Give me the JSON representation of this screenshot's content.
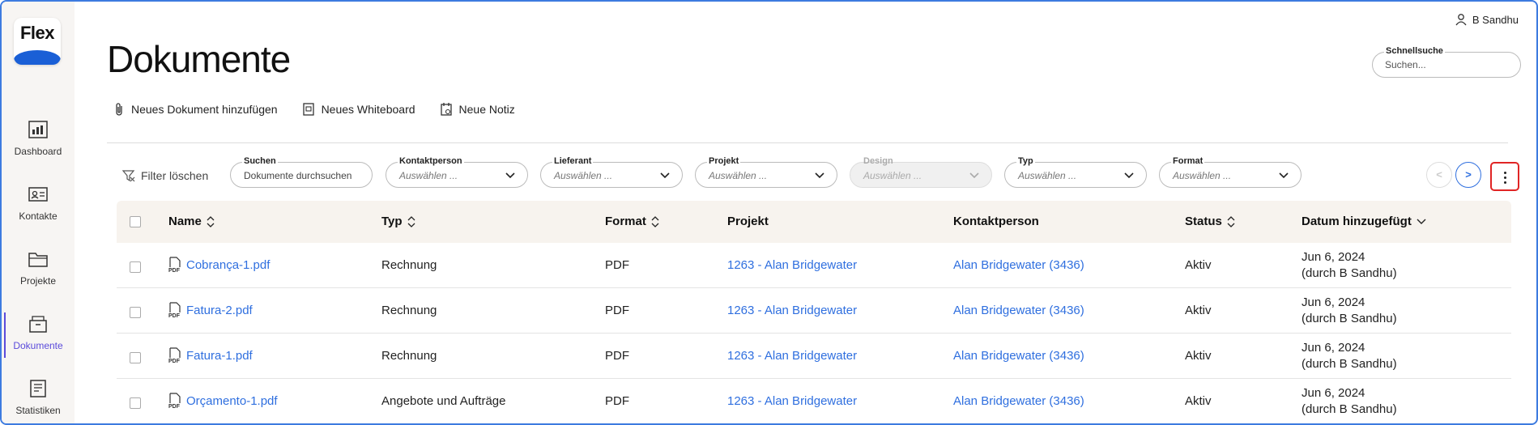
{
  "app": {
    "logo_text": "Flex"
  },
  "user": {
    "name": "B Sandhu"
  },
  "sidebar": {
    "items": [
      {
        "label": "Dashboard"
      },
      {
        "label": "Kontakte"
      },
      {
        "label": "Projekte"
      },
      {
        "label": "Dokumente",
        "active": true
      },
      {
        "label": "Statistiken"
      }
    ]
  },
  "page": {
    "title": "Dokumente"
  },
  "quicksearch": {
    "label": "Schnellsuche",
    "placeholder": "Suchen..."
  },
  "actions": {
    "new_document": "Neues Dokument hinzufügen",
    "new_whiteboard": "Neues Whiteboard",
    "new_note": "Neue Notiz"
  },
  "filters": {
    "clear_label": "Filter löschen",
    "search": {
      "label": "Suchen",
      "value": "Dokumente durchsuchen"
    },
    "contact": {
      "label": "Kontaktperson",
      "value": "Auswählen ..."
    },
    "supplier": {
      "label": "Lieferant",
      "value": "Auswählen ..."
    },
    "project": {
      "label": "Projekt",
      "value": "Auswählen ..."
    },
    "design": {
      "label": "Design",
      "value": "Auswählen ..."
    },
    "type": {
      "label": "Typ",
      "value": "Auswählen ..."
    },
    "format": {
      "label": "Format",
      "value": "Auswählen ..."
    }
  },
  "pager": {
    "prev": "<",
    "next": ">"
  },
  "table": {
    "headers": {
      "name": "Name",
      "type": "Typ",
      "format": "Format",
      "project": "Projekt",
      "contact": "Kontaktperson",
      "status": "Status",
      "date": "Datum hinzugefügt"
    },
    "rows": [
      {
        "name": "Cobrança-1.pdf",
        "type": "Rechnung",
        "format": "PDF",
        "project": "1263 - Alan Bridgewater",
        "contact": "Alan Bridgewater (3436)",
        "status": "Aktiv",
        "date": "Jun 6, 2024",
        "by": "(durch B Sandhu)"
      },
      {
        "name": "Fatura-2.pdf",
        "type": "Rechnung",
        "format": "PDF",
        "project": "1263 - Alan Bridgewater",
        "contact": "Alan Bridgewater (3436)",
        "status": "Aktiv",
        "date": "Jun 6, 2024",
        "by": "(durch B Sandhu)"
      },
      {
        "name": "Fatura-1.pdf",
        "type": "Rechnung",
        "format": "PDF",
        "project": "1263 - Alan Bridgewater",
        "contact": "Alan Bridgewater (3436)",
        "status": "Aktiv",
        "date": "Jun 6, 2024",
        "by": "(durch B Sandhu)"
      },
      {
        "name": "Orçamento-1.pdf",
        "type": "Angebote und Aufträge",
        "format": "PDF",
        "project": "1263 - Alan Bridgewater",
        "contact": "Alan Bridgewater (3436)",
        "status": "Aktiv",
        "date": "Jun 6, 2024",
        "by": "(durch B Sandhu)"
      }
    ]
  },
  "colors": {
    "accent": "#2f6fdf",
    "active_nav": "#5b4bdb",
    "highlight": "#e02424",
    "header_bg": "#f7f3ee"
  }
}
